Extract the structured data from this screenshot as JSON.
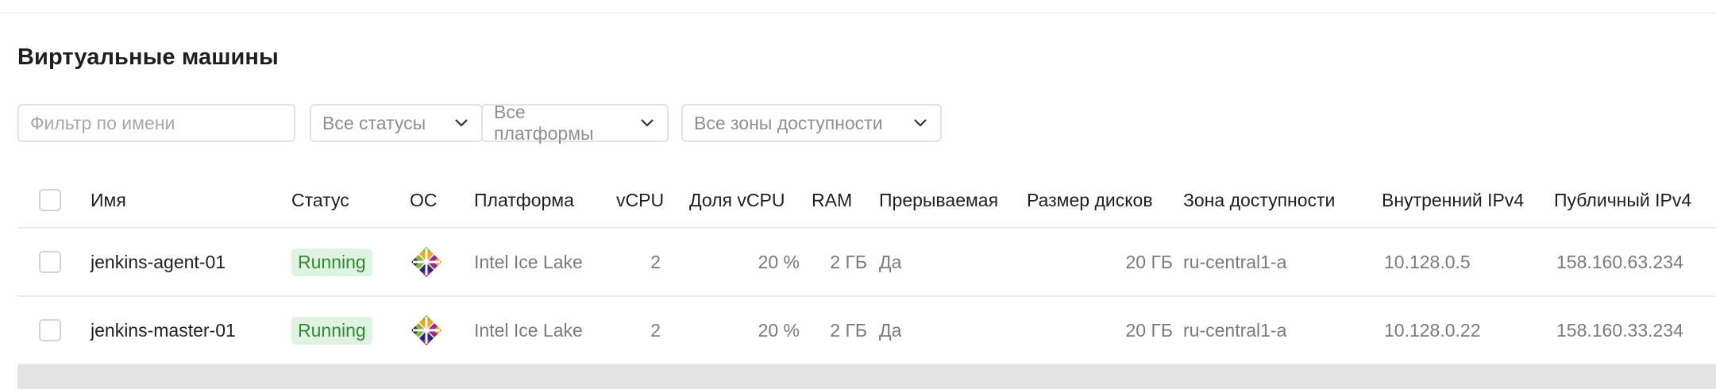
{
  "page": {
    "title": "Виртуальные машины"
  },
  "filters": {
    "name_placeholder": "Фильтр по имени",
    "status_select": "Все статусы",
    "platform_select": "Все платформы",
    "zone_select": "Все зоны доступности"
  },
  "table": {
    "headers": {
      "name": "Имя",
      "status": "Статус",
      "os": "ОС",
      "platform": "Платформа",
      "vcpu": "vCPU",
      "vcpu_share": "Доля vCPU",
      "ram": "RAM",
      "preemptible": "Прерываемая",
      "disk_size": "Размер дисков",
      "zone": "Зона доступности",
      "internal_ip": "Внутренний IPv4",
      "public_ip": "Публичный IPv4"
    },
    "rows": [
      {
        "name": "jenkins-agent-01",
        "status": "Running",
        "os_icon": "centos-icon",
        "platform": "Intel Ice Lake",
        "vcpu": "2",
        "vcpu_share": "20 %",
        "ram": "2 ГБ",
        "preemptible": "Да",
        "disk_size": "20 ГБ",
        "zone": "ru-central1-a",
        "internal_ip": "10.128.0.5",
        "public_ip": "158.160.63.234"
      },
      {
        "name": "jenkins-master-01",
        "status": "Running",
        "os_icon": "centos-icon",
        "platform": "Intel Ice Lake",
        "vcpu": "2",
        "vcpu_share": "20 %",
        "ram": "2 ГБ",
        "preemptible": "Да",
        "disk_size": "20 ГБ",
        "zone": "ru-central1-a",
        "internal_ip": "10.128.0.22",
        "public_ip": "158.160.33.234"
      }
    ]
  },
  "colors": {
    "status_running_bg": "#dff3e0",
    "status_running_text": "#2e8b34"
  }
}
